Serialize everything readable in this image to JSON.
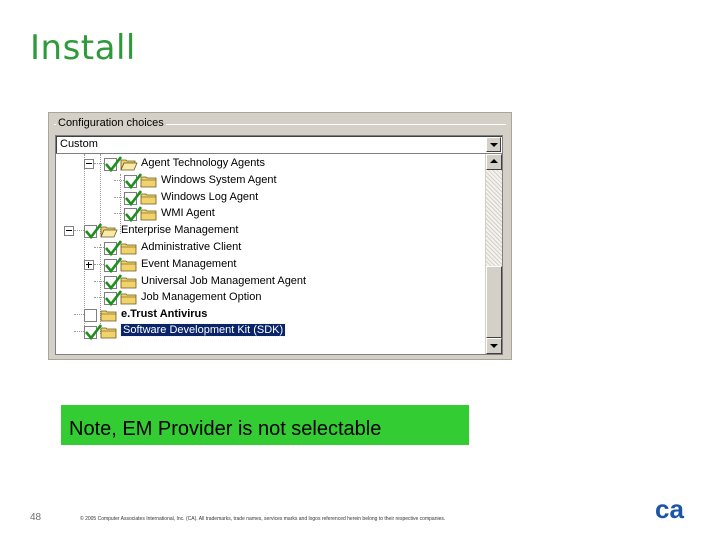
{
  "slide": {
    "title": "Install",
    "page_number": "48",
    "copyright": "© 2005 Computer Associates International, Inc. (CA). All trademarks, trade names, services marks and logos referenced herein belong to their respective companies."
  },
  "dialog": {
    "group_label": "Configuration choices",
    "combo": {
      "value": "Custom"
    },
    "tree": [
      {
        "label": "Agent Technology Agents",
        "checked": true,
        "folder_open": true,
        "expander": "minus",
        "level": 1
      },
      {
        "label": "Windows System Agent",
        "checked": true,
        "level": 2
      },
      {
        "label": "Windows Log Agent",
        "checked": true,
        "level": 2
      },
      {
        "label": "WMI Agent",
        "checked": true,
        "level": 2
      },
      {
        "label": "Enterprise Management",
        "checked": true,
        "folder_open": true,
        "expander": "minus",
        "level": 0
      },
      {
        "label": "Administrative Client",
        "checked": true,
        "level": 1
      },
      {
        "label": "Event Management",
        "checked": true,
        "expander": "plus",
        "level": 1
      },
      {
        "label": "Universal Job Management Agent",
        "checked": true,
        "level": 1
      },
      {
        "label": "Job Management Option",
        "checked": true,
        "level": 1
      },
      {
        "label": "e.Trust Antivirus",
        "checked": false,
        "bold": true,
        "level": 0
      },
      {
        "label": "Software Development Kit (SDK)",
        "checked": true,
        "selected": true,
        "level": 0
      }
    ]
  },
  "note": {
    "text": "Note, EM Provider is not selectable"
  },
  "logo": {
    "text": "ca"
  },
  "colors": {
    "title_green": "#2e9a3a",
    "note_bg": "#33cc33",
    "selection": "#0a246a",
    "check_green": "#1e8f1e",
    "folder_yellow": "#f2d36b",
    "logo_blue": "#1d55a6"
  }
}
